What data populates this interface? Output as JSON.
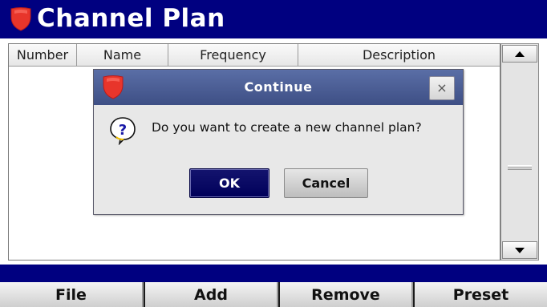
{
  "window": {
    "title": "Channel Plan"
  },
  "table": {
    "columns": [
      "Number",
      "Name",
      "Frequency",
      "Description"
    ],
    "rows": []
  },
  "scrollbar": {
    "up_icon": "scroll-up-arrow-icon",
    "down_icon": "scroll-down-arrow-icon"
  },
  "dialog": {
    "title": "Continue",
    "message": "Do you want to create a new channel plan?",
    "ok_label": "OK",
    "cancel_label": "Cancel",
    "close_symbol": "×",
    "icon": "question-icon"
  },
  "softkeys": [
    "File",
    "Add",
    "Remove",
    "Preset"
  ],
  "colors": {
    "titlebar": "#000080",
    "dialog_header": "#4a5b93",
    "ok_button": "#0a0a66",
    "logo_red": "#e8352b"
  }
}
